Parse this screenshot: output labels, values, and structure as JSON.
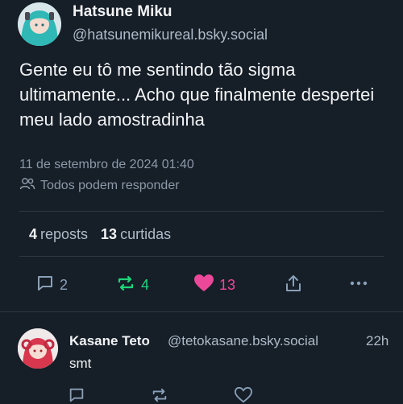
{
  "post": {
    "author": {
      "display_name": "Hatsune Miku",
      "handle": "@hatsunemikureal.bsky.social",
      "avatar_icon": "miku-avatar"
    },
    "text": "Gente eu tô me sentindo tão sigma ultimamente... Acho que finalmente despertei meu lado amostradinha",
    "timestamp": "11 de setembro de 2024 01:40",
    "reply_settings": "Todos podem responder",
    "stats": {
      "reposts_count": "4",
      "reposts_label": "reposts",
      "likes_count": "13",
      "likes_label": "curtidas"
    },
    "actions": {
      "reply_count": "2",
      "repost_count": "4",
      "like_count": "13"
    }
  },
  "reply": {
    "author": {
      "display_name": "Kasane Teto",
      "handle": "@tetokasane.bsky.social",
      "avatar_icon": "teto-avatar"
    },
    "time": "22h",
    "text": "smt"
  },
  "colors": {
    "background": "#161e27",
    "repost_active": "#1ed67a",
    "like_active": "#ec4899",
    "muted": "#8c99a8",
    "icon": "#8aa0b8"
  }
}
